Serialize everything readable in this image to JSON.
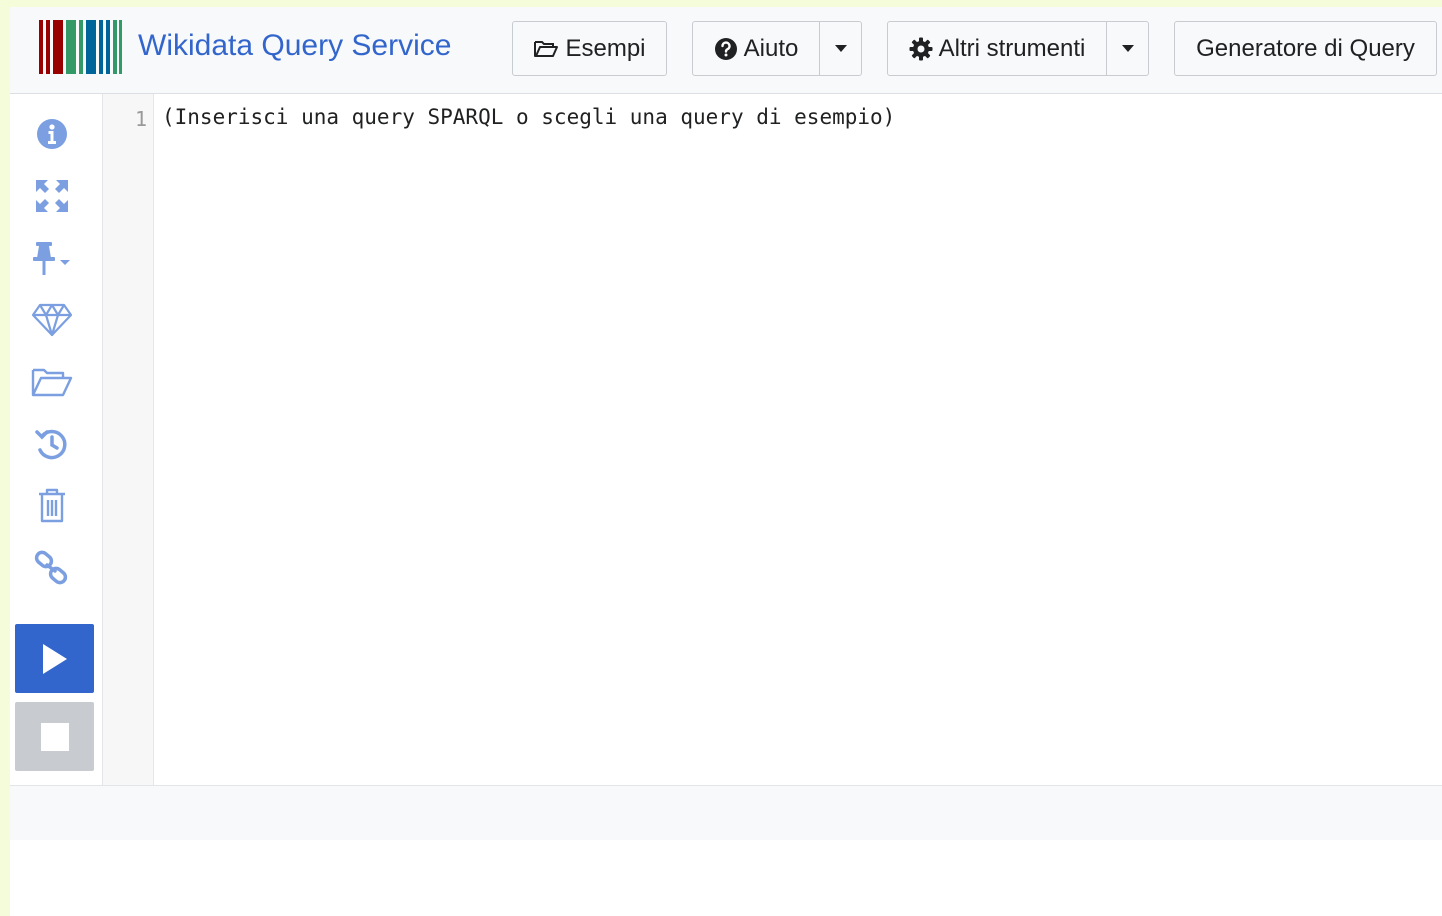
{
  "header": {
    "title": "Wikidata Query Service",
    "logo_icon": "wikidata-barcode-logo",
    "logo_colors": [
      "#990000",
      "#339966",
      "#006699"
    ]
  },
  "nav": {
    "examples_label": "Esempi",
    "examples_icon": "folder-open-icon",
    "help_label": "Aiuto",
    "help_icon": "question-circle-icon",
    "tools_label": "Altri strumenti",
    "tools_icon": "gear-icon",
    "query_builder_label": "Generatore di Query"
  },
  "toolbar": {
    "icons": [
      "info-icon",
      "expand-icon",
      "pin-icon",
      "diamond-icon",
      "folder-open-icon",
      "history-icon",
      "trash-icon",
      "link-icon"
    ],
    "run_icon": "play-icon",
    "stop_icon": "stop-icon",
    "accent_color": "#3366cc",
    "icon_color": "#7b9fe0"
  },
  "editor": {
    "lines": [
      {
        "number": "1",
        "text": "(Inserisci una query SPARQL o scegli una query di esempio)"
      }
    ]
  }
}
